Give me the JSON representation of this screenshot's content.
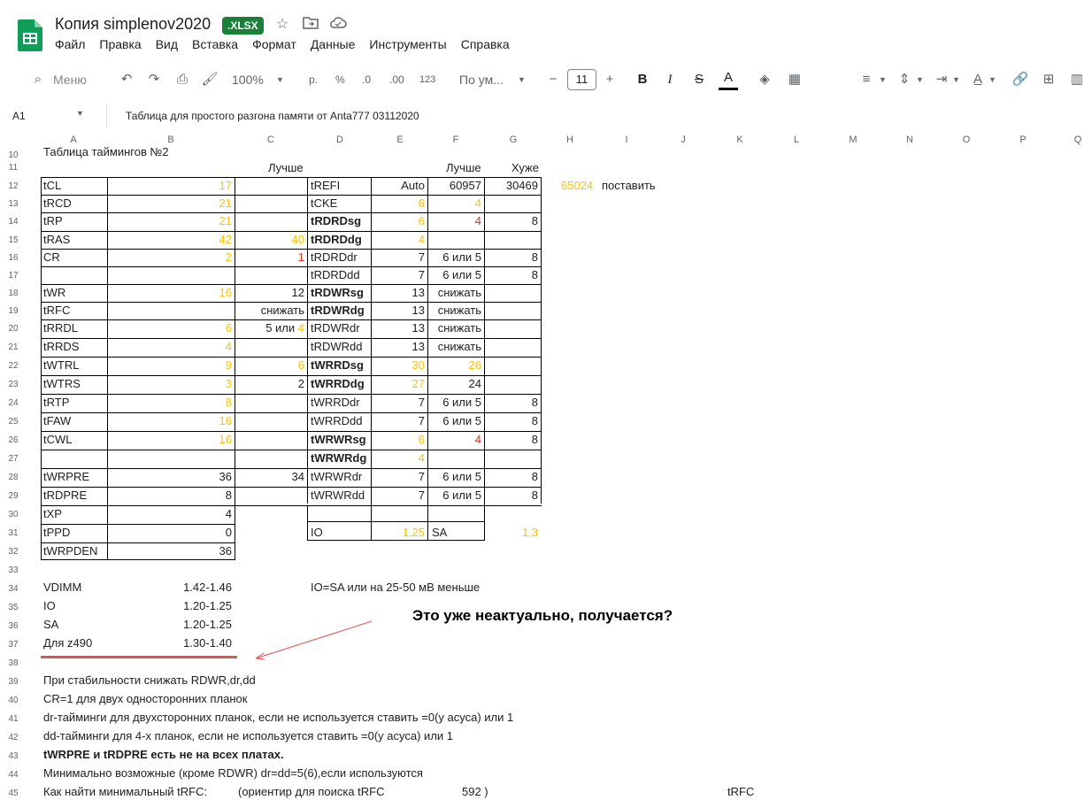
{
  "header": {
    "title": "Копия simplenov2020",
    "badge": ".XLSX"
  },
  "menu": [
    "Файл",
    "Правка",
    "Вид",
    "Вставка",
    "Формат",
    "Данные",
    "Инструменты",
    "Справка"
  ],
  "toolbar": {
    "search": "Меню",
    "zoom": "100%",
    "currency": "р.",
    "percent": "%",
    "dec_less": ".0",
    "dec_more": ".00",
    "format123": "123",
    "font": "По ум...",
    "size": "11",
    "bold": "B",
    "italic": "I",
    "strike": "S",
    "textcolor": "A"
  },
  "formula": {
    "cell": "A1",
    "content": "Таблица для простого разгона памяти от  Anta777 03112020"
  },
  "columns": [
    "A",
    "B",
    "C",
    "D",
    "E",
    "F",
    "G",
    "H",
    "I",
    "J",
    "K",
    "L",
    "M",
    "N",
    "O",
    "P",
    "Q"
  ],
  "rows": {
    "r10": {
      "n": "10",
      "a": "Таблица таймингов №2"
    },
    "r11": {
      "n": "11",
      "c": "Лучше",
      "f": "Лучше",
      "g": "Хуже"
    },
    "r12": {
      "n": "12",
      "a": "tCL",
      "b": "17",
      "d": "tREFI",
      "e": "Auto",
      "f": "60957",
      "g": "30469",
      "h": "65024",
      "i": "поставить"
    },
    "r13": {
      "n": "13",
      "a": "tRCD",
      "b": "21",
      "d": "tCKE",
      "e": "6",
      "f": "4"
    },
    "r14": {
      "n": "14",
      "a": "tRP",
      "b": "21",
      "d": "tRDRDsg",
      "e": "6",
      "f": "4",
      "g": "8"
    },
    "r15": {
      "n": "15",
      "a": "tRAS",
      "b": "42",
      "c": "40",
      "d": "tRDRDdg",
      "e": "4"
    },
    "r16": {
      "n": "16",
      "a": "CR",
      "b": "2",
      "c": "1",
      "d": "tRDRDdr",
      "e": "7",
      "f": "6 или 5",
      "g": "8"
    },
    "r17": {
      "n": "17",
      "d": "tRDRDdd",
      "e": "7",
      "f": "6 или 5",
      "g": "8"
    },
    "r18": {
      "n": "18",
      "a": "tWR",
      "b": "16",
      "c": "12",
      "d": "tRDWRsg",
      "e": "13",
      "f": "снижать"
    },
    "r19": {
      "n": "19",
      "a": "tRFC",
      "c": "снижать",
      "d": "tRDWRdg",
      "e": "13",
      "f": "снижать"
    },
    "r20": {
      "n": "20",
      "a": "tRRDL",
      "b": "6",
      "c1": "5 или ",
      "c2": "4",
      "d": "tRDWRdr",
      "e": "13",
      "f": "снижать"
    },
    "r21": {
      "n": "21",
      "a": "tRRDS",
      "b": "4",
      "d": "tRDWRdd",
      "e": "13",
      "f": "снижать"
    },
    "r22": {
      "n": "22",
      "a": "tWTRL",
      "b": "9",
      "c": "6",
      "d": "tWRRDsg",
      "e": "30",
      "f": "26"
    },
    "r23": {
      "n": "23",
      "a": "tWTRS",
      "b": "3",
      "c": "2",
      "d": "tWRRDdg",
      "e": "27",
      "f": "24"
    },
    "r24": {
      "n": "24",
      "a": "tRTP",
      "b": "8",
      "d": "tWRRDdr",
      "e": "7",
      "f": "6 или 5",
      "g": "8"
    },
    "r25": {
      "n": "25",
      "a": "tFAW",
      "b": "16",
      "d": "tWRRDdd",
      "e": "7",
      "f": "6 или 5",
      "g": "8"
    },
    "r26": {
      "n": "26",
      "a": "tCWL",
      "b": "16",
      "d": "tWRWRsg",
      "e": "6",
      "f": "4",
      "g": "8"
    },
    "r27": {
      "n": "27",
      "d": "tWRWRdg",
      "e": "4"
    },
    "r28": {
      "n": "28",
      "a": "tWRPRE",
      "b": "36",
      "c": "34",
      "d": "tWRWRdr",
      "e": "7",
      "f": "6 или 5",
      "g": "8"
    },
    "r29": {
      "n": "29",
      "a": "tRDPRE",
      "b": "8",
      "d": "tWRWRdd",
      "e": "7",
      "f": "6 или 5",
      "g": "8"
    },
    "r30": {
      "n": "30",
      "a": "tXP",
      "b": "4"
    },
    "r31": {
      "n": "31",
      "a": "tPPD",
      "b": "0",
      "d": "IO",
      "e": "1,25",
      "f": "SA",
      "g": "1,3"
    },
    "r32": {
      "n": "32",
      "a": "tWRPDEN",
      "b": "36"
    },
    "r33": {
      "n": "33"
    },
    "r34": {
      "n": "34",
      "a": "VDIMM",
      "b": "1.42-1.46",
      "d": "IO=SA или на 25-50 мВ меньше"
    },
    "r35": {
      "n": "35",
      "a": "IO",
      "b": "1.20-1.25"
    },
    "r36": {
      "n": "36",
      "a": "SA",
      "b": "1.20-1.25"
    },
    "r37": {
      "n": "37",
      "a": "Для z490",
      "b": "1.30-1.40"
    },
    "r38": {
      "n": "38"
    },
    "r39": {
      "n": "39",
      "a": "При стабильности снижать RDWR,dr,dd"
    },
    "r40": {
      "n": "40",
      "a": "CR=1 для двух односторонних планок"
    },
    "r41": {
      "n": "41",
      "a": "dr-тайминги для двухсторонних планок, если не используется ставить =0(у асуса) или 1"
    },
    "r42": {
      "n": "42",
      "a": "dd-тайминги для 4-х планок, если не используется ставить =0(у асуса) или 1"
    },
    "r43": {
      "n": "43",
      "a": "tWRPRE и tRDPRE есть не на всех платах."
    },
    "r44": {
      "n": "44",
      "a": "Минимально возможные (кроме RDWR) dr=dd=5(6),если используются"
    },
    "r45": {
      "n": "45",
      "a": "Как найти минимальный tRFC:",
      "c": "(ориентир для поиска tRFC",
      "e": "592  )",
      "k": "tRFC"
    }
  },
  "annotation": "Это уже неактуально, получается?",
  "colors": {
    "accent": "#188038",
    "yellow": "#ffc107",
    "red": "#d93025",
    "annotation_line": "#e05252"
  }
}
